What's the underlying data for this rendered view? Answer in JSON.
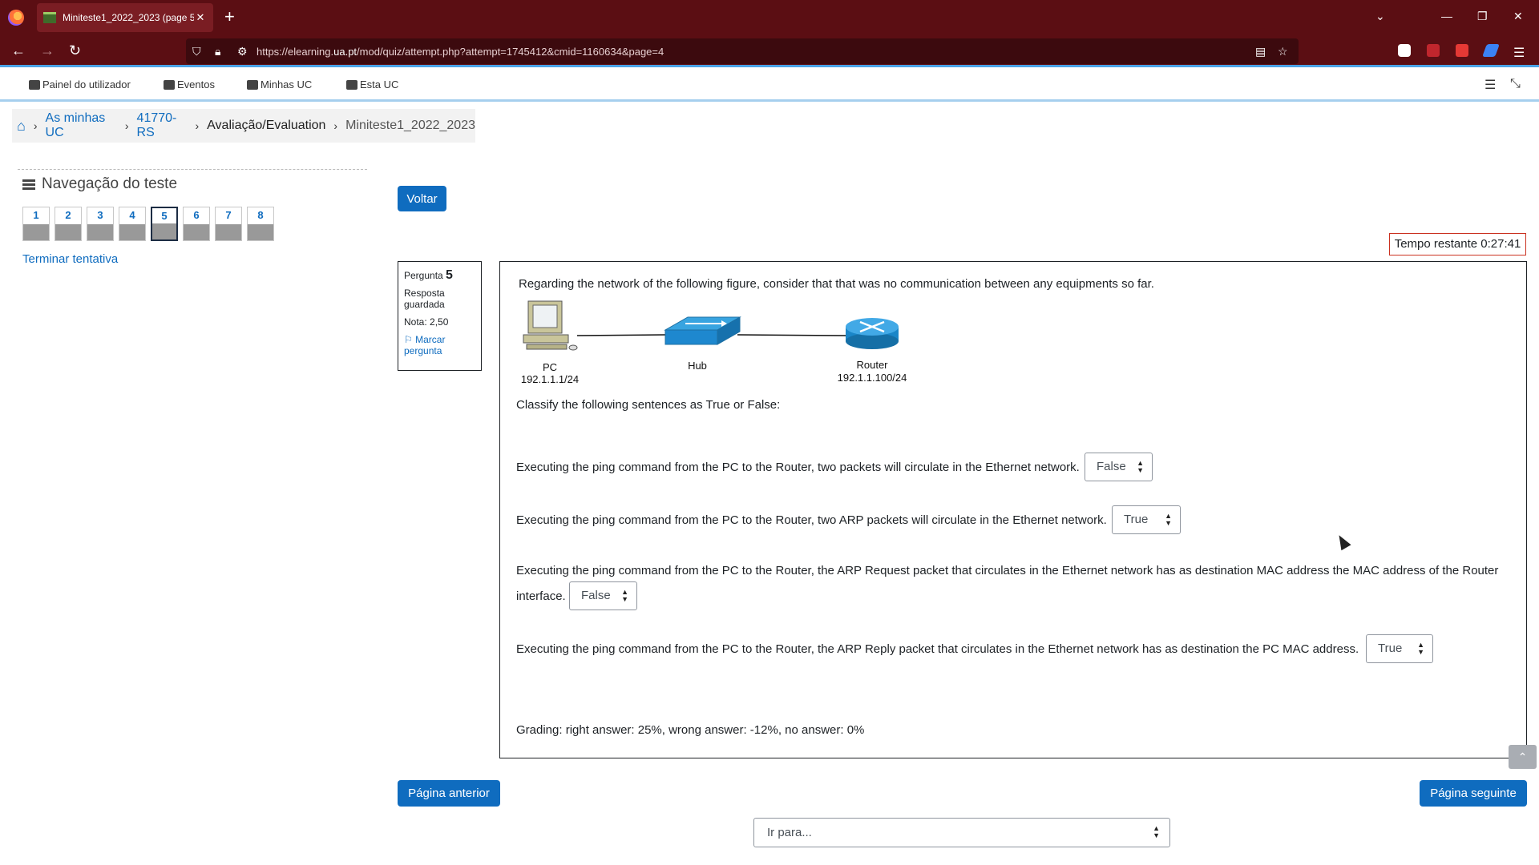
{
  "browser": {
    "tab_title": "Miniteste1_2022_2023 (page 5 of",
    "url_prefix": "https://elearning.",
    "url_domain": "ua.pt",
    "url_suffix": "/mod/quiz/attempt.php?attempt=1745412&cmid=1160634&page=4"
  },
  "moodle_nav": {
    "items": [
      "Painel do utilizador",
      "Eventos",
      "Minhas UC",
      "Esta UC"
    ]
  },
  "breadcrumb": {
    "items": [
      "As minhas UC",
      "41770-RS",
      "Avaliação/Evaluation",
      "Miniteste1_2022_2023"
    ]
  },
  "quiz_nav": {
    "title": "Navegação do teste",
    "questions": [
      "1",
      "2",
      "3",
      "4",
      "5",
      "6",
      "7",
      "8"
    ],
    "current": "5",
    "finish_label": "Terminar tentativa"
  },
  "back_button": "Voltar",
  "timer": "Tempo restante 0:27:41",
  "question_info": {
    "label": "Pergunta",
    "number": "5",
    "status": "Resposta guardada",
    "grade": "Nota: 2,50",
    "flag": "Marcar pergunta"
  },
  "question": {
    "intro": "Regarding the network of the following figure, consider that that was no communication between any equipments so far.",
    "diagram": {
      "pc_label": "PC",
      "pc_ip": "192.1.1.1/24",
      "hub_label": "Hub",
      "router_label": "Router",
      "router_ip": "192.1.1.100/24"
    },
    "classify": "Classify the following sentences as True or False:",
    "items": [
      {
        "text": "Executing the ping command from the PC to the Router, two packets will circulate in the Ethernet network.",
        "answer": "False"
      },
      {
        "text": "Executing the ping command from the PC to the Router, two ARP packets will circulate in the Ethernet network.",
        "answer": "True"
      },
      {
        "text": "Executing the ping command from the PC to the Router, the ARP Request packet that circulates in the Ethernet network has as destination MAC address the MAC address of the Router",
        "text_cont": "interface.",
        "answer": "False"
      },
      {
        "text": "Executing the ping command from the PC to the Router, the ARP Reply packet that circulates in the Ethernet network has as destination the PC MAC address.",
        "answer": "True"
      }
    ],
    "grading": "Grading: right answer: 25%, wrong answer: -12%, no answer: 0%"
  },
  "prev_page": "Página anterior",
  "next_page": "Página seguinte",
  "jump_placeholder": "Ir para...",
  "colors": {
    "browser_chrome": "#5b0e13",
    "primary": "#0f6cbf",
    "timer_border": "#ca3120"
  }
}
